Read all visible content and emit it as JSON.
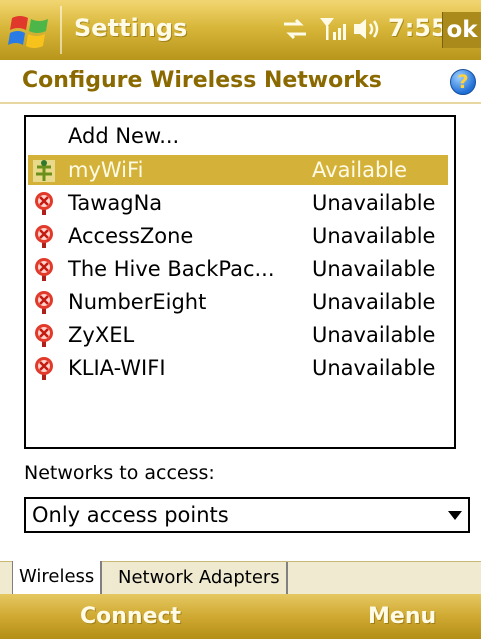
{
  "titlebar": {
    "title": "Settings",
    "time": "7:55",
    "ok_label": "ok"
  },
  "header": {
    "title": "Configure Wireless Networks"
  },
  "list": {
    "add_new": "Add New...",
    "networks": [
      {
        "name": "myWiFi",
        "status": "Available",
        "selected": true,
        "icon": "access-point-icon"
      },
      {
        "name": "TawagNa",
        "status": "Unavailable",
        "icon": "unavailable-network-icon"
      },
      {
        "name": "AccessZone",
        "status": "Unavailable",
        "icon": "unavailable-network-icon"
      },
      {
        "name": "The Hive BackPac...",
        "status": "Unavailable",
        "icon": "unavailable-network-icon"
      },
      {
        "name": "NumberEight",
        "status": "Unavailable",
        "icon": "unavailable-network-icon"
      },
      {
        "name": "ZyXEL",
        "status": "Unavailable",
        "icon": "unavailable-network-icon"
      },
      {
        "name": "KLIA-WIFI",
        "status": "Unavailable",
        "icon": "unavailable-network-icon"
      }
    ]
  },
  "networks_to_access": {
    "label": "Networks to access:",
    "selected": "Only access points"
  },
  "tabs": [
    {
      "label": "Wireless",
      "active": true
    },
    {
      "label": "Network Adapters",
      "active": false
    }
  ],
  "softkeys": {
    "left": "Connect",
    "right": "Menu"
  },
  "colors": {
    "accent": "#d4b23a",
    "header_text": "#8a6a00"
  }
}
